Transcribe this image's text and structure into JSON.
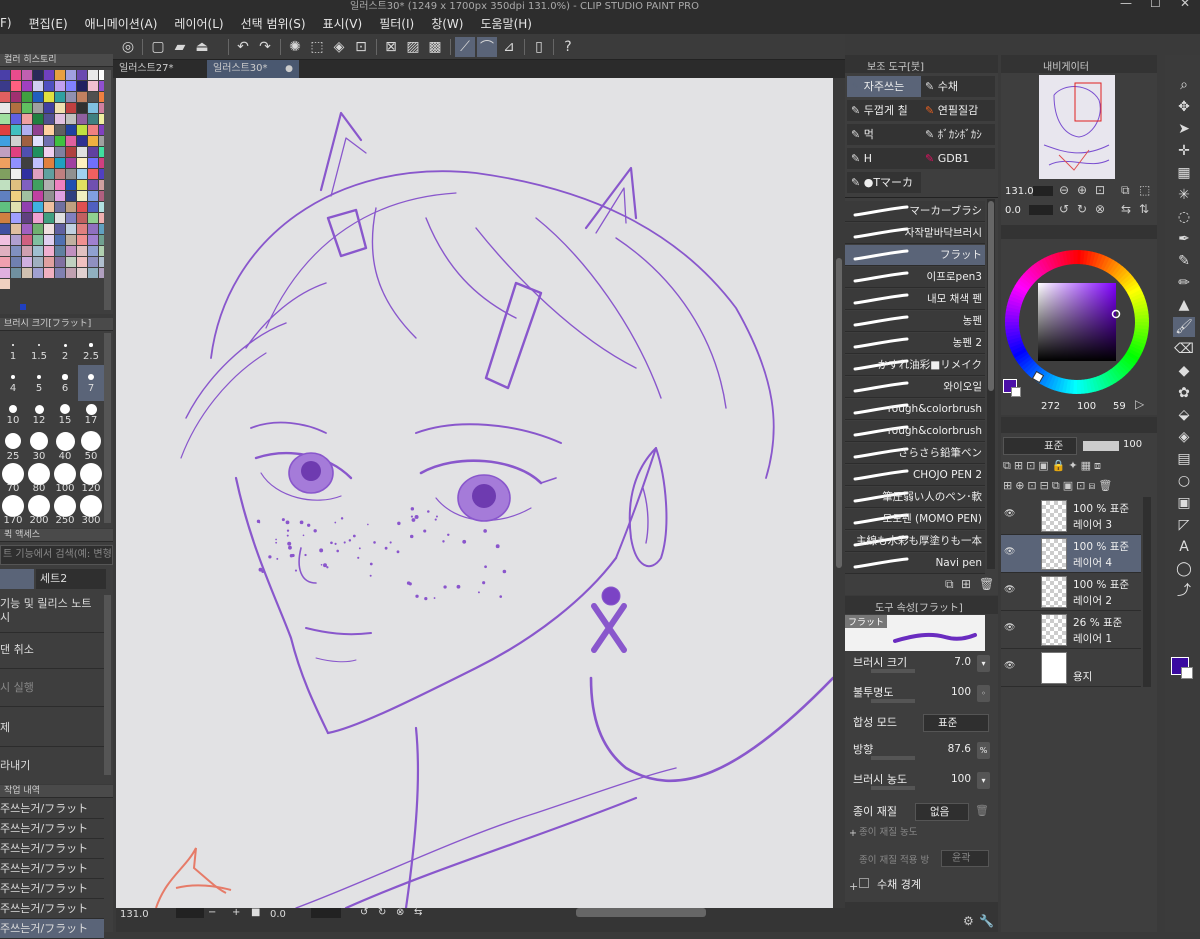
{
  "window": {
    "title": "일러스트30* (1249 x 1700px 350dpi 131.0%)  - CLIP STUDIO PAINT PRO"
  },
  "menu": [
    "F)",
    "편집(E)",
    "애니메이션(A)",
    "레이어(L)",
    "선택 범위(S)",
    "표시(V)",
    "필터(I)",
    "창(W)",
    "도움말(H)"
  ],
  "color_history": {
    "title": "컬러 히스토리",
    "swatches": [
      "#4a3fa8",
      "#e84c8c",
      "#c060b0",
      "#2a2a5a",
      "#7040c0",
      "#e8a040",
      "#a0a0e0",
      "#6a4ab0",
      "#e8e8e8",
      "#ffffff",
      "#3a3a8a",
      "#ff6080",
      "#a040c0",
      "#d0d0f0",
      "#5050c0",
      "#c0a0f0",
      "#8080ff",
      "#202060",
      "#f0c0d0",
      "#9050d0",
      "#e06060",
      "#a03070",
      "#40a040",
      "#2060c0",
      "#e0e040",
      "#30a0a0",
      "#9090b0",
      "#c08060",
      "#505050",
      "#f08040",
      "#e8e8e8",
      "#b07040",
      "#60c060",
      "#a0a0a0",
      "#4040a0",
      "#f0e0b0",
      "#c04040",
      "#303030",
      "#80c0e0",
      "#d080a0",
      "#a0e0a0",
      "#6060e0",
      "#f0a0a0",
      "#208040",
      "#505090",
      "#e0c0e0",
      "#c0c0c0",
      "#9060a0",
      "#408080",
      "#f0f0a0",
      "#e04040",
      "#40c0c0",
      "#b0b0f0",
      "#904090",
      "#ffd0a0",
      "#606060",
      "#2040a0",
      "#c0e040",
      "#f08080",
      "#8040c0",
      "#40a0e0",
      "#d0d0d0",
      "#a06040",
      "#e0e0ff",
      "#7070b0",
      "#40c040",
      "#e060a0",
      "#303090",
      "#f0b040",
      "#a0a0a0",
      "#c0a0c0",
      "#e04080",
      "#5050b0",
      "#209060",
      "#f0d0f0",
      "#8080a0",
      "#b04040",
      "#e0e0e0",
      "#6040a0",
      "#40e0a0",
      "#f0a060",
      "#9090ff",
      "#404040",
      "#c0c0ff",
      "#e08040",
      "#20a0c0",
      "#a040a0",
      "#fff0c0",
      "#7070ff",
      "#d04080",
      "#80a060",
      "#f0f0f0",
      "#3030a0",
      "#e0a0c0",
      "#60a0a0",
      "#c08080",
      "#909090",
      "#a0d0f0",
      "#f06060",
      "#5040c0",
      "#c0e0c0",
      "#e0c080",
      "#8060c0",
      "#40a060",
      "#b0b0b0",
      "#f080c0",
      "#2050b0",
      "#e0e060",
      "#7050b0",
      "#d0a0a0",
      "#6080c0",
      "#f0d080",
      "#a0c0a0",
      "#c040a0",
      "#909090",
      "#e0a0e0",
      "#304080",
      "#f0f0c0",
      "#80a0e0",
      "#b06080",
      "#60c080",
      "#e0e0b0",
      "#9040b0",
      "#40b0e0",
      "#f0c0a0",
      "#7070a0",
      "#c0a080",
      "#e05050",
      "#5060c0",
      "#b0e0e0",
      "#d08040",
      "#a0a0ff",
      "#604080",
      "#f0a0d0",
      "#40a080",
      "#e0e0e0",
      "#8080c0",
      "#c06060",
      "#90d090",
      "#f0b0b0",
      "#4050a0",
      "#e0c0a0",
      "#a060c0",
      "#70b070",
      "#f0e0e0",
      "#6060a0",
      "#c0d0e0",
      "#e08080",
      "#9070c0",
      "#60a0c0",
      "#f0c0e0",
      "#b0a0d0",
      "#d06080",
      "#80c0a0",
      "#e0d0f0",
      "#5070b0",
      "#c0b0a0",
      "#f09090",
      "#a080d0",
      "#70a090",
      "#e0b0c0",
      "#8090c0",
      "#d0a0b0",
      "#a0c0d0",
      "#f0b0d0",
      "#6080a0",
      "#c090c0",
      "#e0c0c0",
      "#90a0d0",
      "#b0d0b0",
      "#f0a0b0",
      "#7080b0",
      "#d0b0e0",
      "#a0b0c0",
      "#e0a0a0",
      "#8070a0",
      "#c0d0c0",
      "#f0c0c0",
      "#9090c0",
      "#b0c0d0",
      "#e0b0e0",
      "#7090a0",
      "#d0c0b0",
      "#a0a0d0",
      "#f0b0c0",
      "#8080b0",
      "#c0a0b0",
      "#e0d0d0",
      "#90b0c0",
      "#b0a0c0",
      "#f0d0c0"
    ]
  },
  "brush_size": {
    "title": "브러시 크기[フラット]",
    "sizes": [
      "1",
      "1.5",
      "2",
      "2.5",
      "4",
      "5",
      "6",
      "7",
      "10",
      "12",
      "15",
      "17",
      "25",
      "30",
      "40",
      "50",
      "70",
      "80",
      "100",
      "120",
      "170",
      "200",
      "250",
      "300"
    ],
    "selected": "7"
  },
  "quick_access": {
    "title": "퀵 액세스",
    "search_placeholder": "트 기능에서 검색(예: 변형",
    "set_label": "세트2",
    "items": [
      "기능 및 릴리스 노트 시",
      "댄 취소",
      "시 실행",
      "제",
      "라내기"
    ]
  },
  "history": {
    "title": "작업 내역",
    "items": [
      "주쓰는거/フラット",
      "주쓰는거/フラット",
      "주쓰는거/フラット",
      "주쓰는거/フラット",
      "주쓰는거/フラット",
      "주쓰는거/フラット",
      "주쓰는거/フラット"
    ]
  },
  "documents": {
    "tabs": [
      {
        "label": "일러스트27*",
        "active": false
      },
      {
        "label": "일러스트30*",
        "active": true
      }
    ]
  },
  "status": {
    "zoom": "131.0",
    "angle": "0.0"
  },
  "subtool": {
    "title": "보조 도구[붓]",
    "groups": [
      "자주쓰는",
      "수채",
      "두껍게 칠",
      "연필질감",
      "먹",
      "ﾎﾞｶｼﾎﾞｶｼ",
      "H",
      "GDB1",
      "●Tマーカ"
    ],
    "brushes": [
      "マーカーブラシ",
      "자작말바닥브러시",
      "フラット",
      "이프로pen3",
      "내모 채색 펜",
      "농펜",
      "농펜 2",
      "かすれ油彩■リメイク",
      "와이오일",
      "rough&colorbrush",
      "rough&colorbrush",
      "さらさら鉛筆ペン",
      "CHOJO PEN 2",
      "筆圧弱い人のペン･軟",
      "모모펜 (MOMO PEN)",
      "主線も水彩も厚塗りも一本",
      "Navi pen"
    ],
    "selected_brush": "フラット"
  },
  "tool_property": {
    "title": "도구 속성[フラット]",
    "preview_label": "フラット",
    "brush_size_label": "브러시 크기",
    "brush_size_value": "7.0",
    "opacity_label": "불투명도",
    "opacity_value": "100",
    "blend_label": "합성 모드",
    "blend_value": "표준",
    "direction_label": "방향",
    "direction_value": "87.6",
    "density_label": "브러시 농도",
    "density_value": "100",
    "paper_label": "종이 재질",
    "paper_value": "없음",
    "paper_density_label": "종이 재질 농도",
    "paper_apply_label": "종이 재질 적용 방",
    "paper_apply_value": "윤곽",
    "watercolor_label": "수채 경계"
  },
  "navigator": {
    "title": "내비게이터",
    "zoom": "131.0",
    "angle": "0.0"
  },
  "color_wheel": {
    "hue": 270,
    "current_color": "#4b10a8",
    "h_value": "272",
    "s_value": "100",
    "v_value": "59"
  },
  "layer_panel": {
    "blend": "표준",
    "opacity": "100",
    "layers": [
      {
        "opacity": "100 % 표준",
        "name": "레이어 3",
        "selected": false
      },
      {
        "opacity": "100 % 표준",
        "name": "레이어 4",
        "selected": true
      },
      {
        "opacity": "100 % 표준",
        "name": "레이어 2",
        "selected": false
      },
      {
        "opacity": "26 % 표준",
        "name": "레이어 1",
        "selected": false
      },
      {
        "opacity": "",
        "name": "용지",
        "selected": false
      }
    ]
  },
  "colors": {
    "accent": "#5a6478",
    "ink": "#7a3fc8",
    "main_color": "#3a0aa0"
  }
}
